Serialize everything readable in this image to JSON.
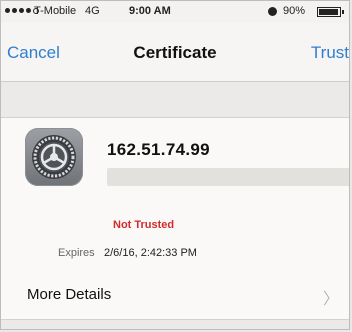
{
  "status_bar": {
    "carrier": "T-Mobile",
    "network": "4G",
    "time": "9:00 AM",
    "battery": "90%"
  },
  "nav": {
    "cancel_label": "Cancel",
    "title": "Certificate",
    "trust_label": "Trust"
  },
  "certificate": {
    "icon": "settings-gear-icon",
    "host": "162.51.74.99",
    "trust_status": "Not Trusted",
    "expires_label": "Expires",
    "expires_value": "2/6/16, 2:42:33 PM"
  },
  "details": {
    "label": "More Details"
  },
  "colors": {
    "accent": "#2f7fcf",
    "warning": "#cf2b2b"
  }
}
